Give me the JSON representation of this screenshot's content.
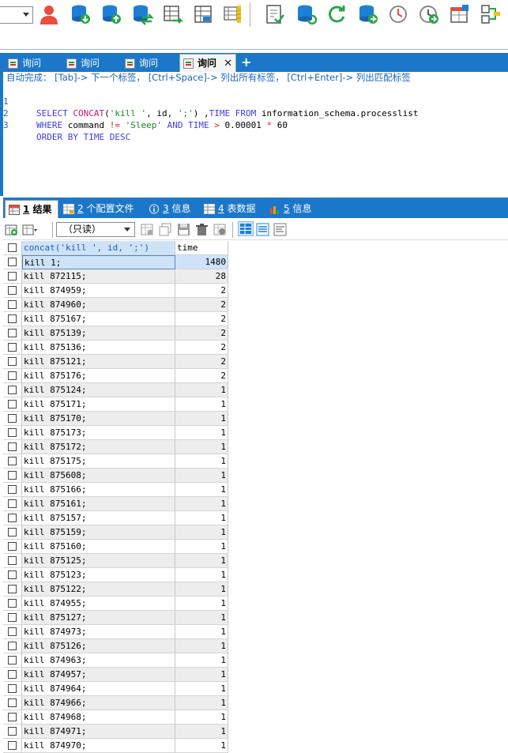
{
  "toolbar": {
    "database_value": "",
    "icons": [
      "user-icon",
      "db-download-icon",
      "db-upload-icon",
      "db-sync-icon",
      "table-export-icon",
      "table-structure-icon",
      "schema-icon",
      "new-query-icon",
      "db-refresh-icon",
      "refresh-icon",
      "db-backup-icon",
      "history-icon",
      "schedule-icon",
      "new-window-icon",
      "compare-icon"
    ]
  },
  "editor_tabs": [
    {
      "label": "询问",
      "active": false
    },
    {
      "label": "询问",
      "active": false
    },
    {
      "label": "询问",
      "active": false
    },
    {
      "label": "询问",
      "active": true
    }
  ],
  "editor": {
    "autocomplete_hint": "自动完成： [Tab]-> 下一个标签， [Ctrl+Space]-> 列出所有标签， [Ctrl+Enter]-> 列出匹配标签",
    "lines": [
      "1",
      "2",
      "3"
    ]
  },
  "result_tabs": [
    {
      "num": "1",
      "label": " 结果",
      "active": true
    },
    {
      "num": "2",
      "label": " 个配置文件",
      "active": false
    },
    {
      "num": "3",
      "label": " 信息",
      "active": false
    },
    {
      "num": "4",
      "label": " 表数据",
      "active": false
    },
    {
      "num": "5",
      "label": " 信息",
      "active": false
    }
  ],
  "grid_toolbar": {
    "readonly_label": "（只读）"
  },
  "grid": {
    "columns": [
      "concat('kill ', id, ';')",
      "time"
    ],
    "rows": [
      [
        "kill 1;",
        "1480"
      ],
      [
        "kill 872115;",
        "28"
      ],
      [
        "kill 874959;",
        "2"
      ],
      [
        "kill 874960;",
        "2"
      ],
      [
        "kill 875167;",
        "2"
      ],
      [
        "kill 875139;",
        "2"
      ],
      [
        "kill 875136;",
        "2"
      ],
      [
        "kill 875121;",
        "2"
      ],
      [
        "kill 875176;",
        "2"
      ],
      [
        "kill 875124;",
        "1"
      ],
      [
        "kill 875171;",
        "1"
      ],
      [
        "kill 875170;",
        "1"
      ],
      [
        "kill 875173;",
        "1"
      ],
      [
        "kill 875172;",
        "1"
      ],
      [
        "kill 875175;",
        "1"
      ],
      [
        "kill 875608;",
        "1"
      ],
      [
        "kill 875166;",
        "1"
      ],
      [
        "kill 875161;",
        "1"
      ],
      [
        "kill 875157;",
        "1"
      ],
      [
        "kill 875159;",
        "1"
      ],
      [
        "kill 875160;",
        "1"
      ],
      [
        "kill 875125;",
        "1"
      ],
      [
        "kill 875123;",
        "1"
      ],
      [
        "kill 875122;",
        "1"
      ],
      [
        "kill 874955;",
        "1"
      ],
      [
        "kill 875127;",
        "1"
      ],
      [
        "kill 874973;",
        "1"
      ],
      [
        "kill 875126;",
        "1"
      ],
      [
        "kill 874963;",
        "1"
      ],
      [
        "kill 874957;",
        "1"
      ],
      [
        "kill 874964;",
        "1"
      ],
      [
        "kill 874966;",
        "1"
      ],
      [
        "kill 874968;",
        "1"
      ],
      [
        "kill 874971;",
        "1"
      ],
      [
        "kill 874970;",
        "1"
      ]
    ]
  },
  "sql": {
    "l1_select": "SELECT ",
    "l1_concat": "CONCAT",
    "l1_open": "(",
    "l1_str1": "'kill '",
    "l1_mid": ", id, ",
    "l1_str2": "';'",
    "l1_close": ") ,",
    "l1_time": "TIME ",
    "l1_from": "FROM ",
    "l1_table": "information_schema.processlist",
    "l2_where": "WHERE ",
    "l2_cmd": "command ",
    "l2_neq": "!= ",
    "l2_str": "'Sleep' ",
    "l2_and": "AND ",
    "l2_time": "TIME ",
    "l2_gt": "> ",
    "l2_num": "0.00001 ",
    "l2_mul": "* ",
    "l2_num2": "60",
    "l3_order": "ORDER BY TIME DESC"
  }
}
